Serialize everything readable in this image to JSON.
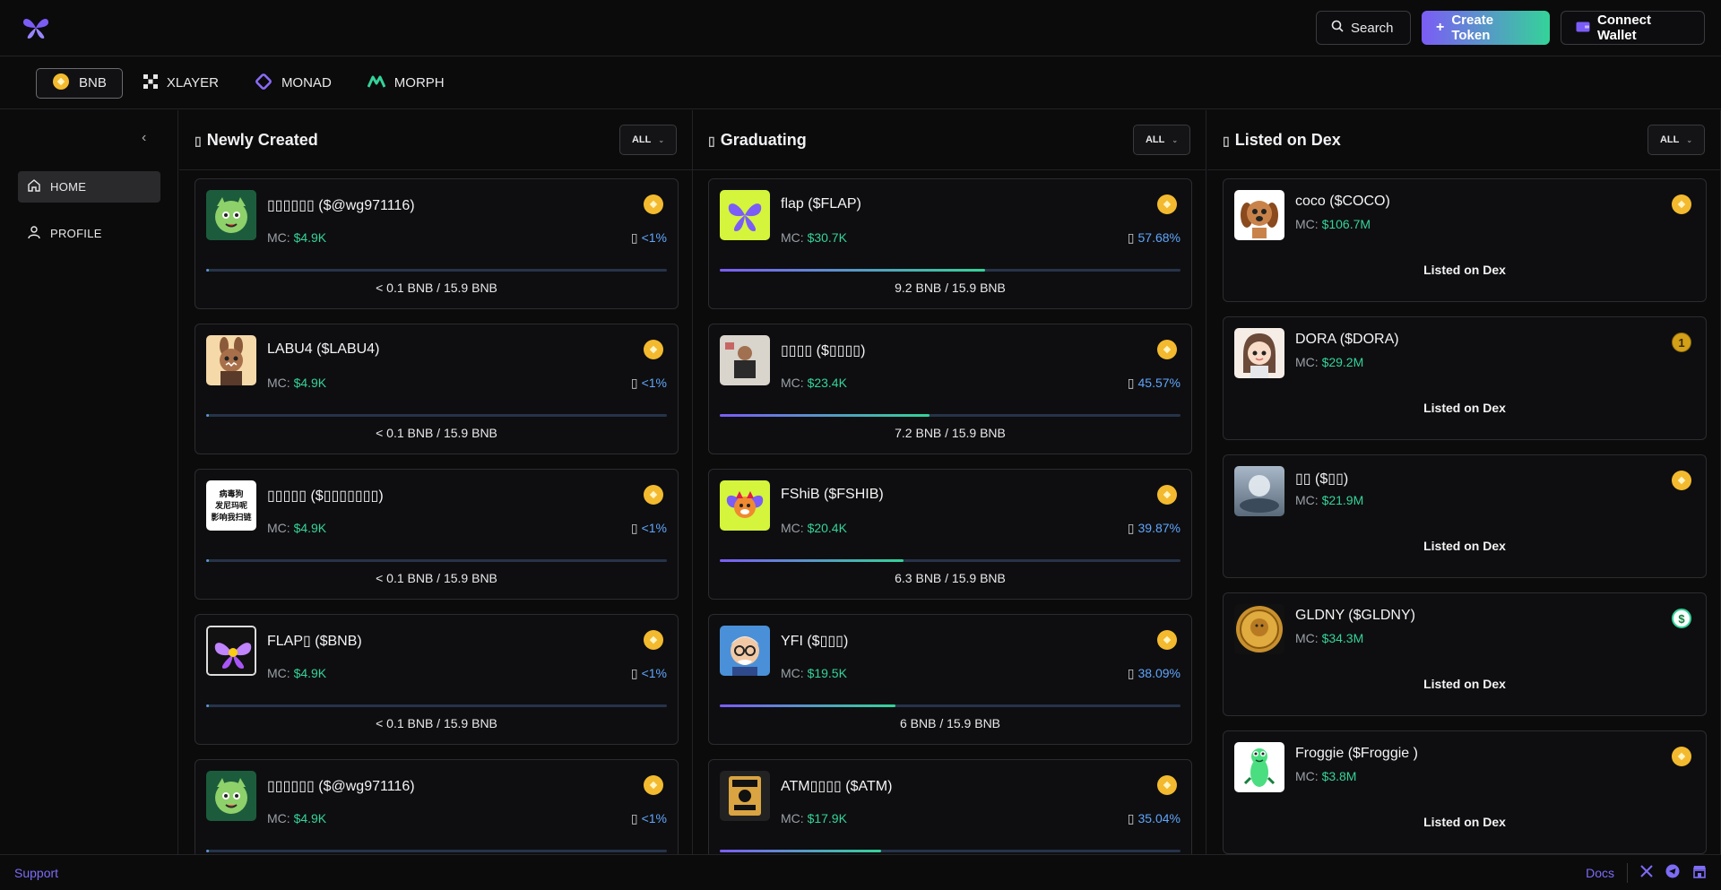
{
  "header": {
    "search_label": "Search",
    "create_label": "Create Token",
    "wallet_label": "Connect Wallet"
  },
  "chains": [
    {
      "label": "BNB",
      "icon": "bnb-coin-icon",
      "active": true
    },
    {
      "label": "XLAYER",
      "icon": "xlayer-icon"
    },
    {
      "label": "MONAD",
      "icon": "monad-icon"
    },
    {
      "label": "MORPH",
      "icon": "morph-icon"
    }
  ],
  "sidebar": {
    "items": [
      {
        "label": "HOME",
        "icon": "home-icon"
      },
      {
        "label": "PROFILE",
        "icon": "user-icon"
      }
    ]
  },
  "columns": [
    {
      "title": "Newly Created",
      "filter": "ALL"
    },
    {
      "title": "Graduating",
      "filter": "ALL"
    },
    {
      "title": "Listed on Dex",
      "filter": "ALL"
    }
  ],
  "newly_created": [
    {
      "name": "▯▯▯▯▯▯ ($@wg971116)",
      "mc_label": "MC:",
      "mc": "$4.9K",
      "pct": "<1%",
      "progress": 0.003,
      "progress_label": "< 0.1 BNB / 15.9 BNB"
    },
    {
      "name": "LABU4 ($LABU4)",
      "mc_label": "MC:",
      "mc": "$4.9K",
      "pct": "<1%",
      "progress": 0.003,
      "progress_label": "< 0.1 BNB / 15.9 BNB"
    },
    {
      "name": "▯▯▯▯▯ ($▯▯▯▯▯▯▯)",
      "mc_label": "MC:",
      "mc": "$4.9K",
      "pct": "<1%",
      "progress": 0.003,
      "progress_label": "< 0.1 BNB / 15.9 BNB",
      "avatar_text": [
        "病毒狗",
        "发尼玛呢",
        "影响我扫链"
      ]
    },
    {
      "name": "FLAP▯ ($BNB)",
      "mc_label": "MC:",
      "mc": "$4.9K",
      "pct": "<1%",
      "progress": 0.003,
      "progress_label": "< 0.1 BNB / 15.9 BNB"
    },
    {
      "name": "▯▯▯▯▯▯ ($@wg971116)",
      "mc_label": "MC:",
      "mc": "$4.9K",
      "pct": "<1%",
      "progress": 0.003,
      "progress_label": ""
    }
  ],
  "graduating": [
    {
      "name": "flap ($FLAP)",
      "mc_label": "MC:",
      "mc": "$30.7K",
      "pct": "57.68%",
      "progress": 0.5768,
      "progress_label": "9.2 BNB / 15.9 BNB"
    },
    {
      "name": "▯▯▯▯ ($▯▯▯▯)",
      "mc_label": "MC:",
      "mc": "$23.4K",
      "pct": "45.57%",
      "progress": 0.4557,
      "progress_label": "7.2 BNB / 15.9 BNB"
    },
    {
      "name": "FShiB ($FSHIB)",
      "mc_label": "MC:",
      "mc": "$20.4K",
      "pct": "39.87%",
      "progress": 0.3987,
      "progress_label": "6.3 BNB / 15.9 BNB"
    },
    {
      "name": "YFI ($▯▯▯)",
      "mc_label": "MC:",
      "mc": "$19.5K",
      "pct": "38.09%",
      "progress": 0.3809,
      "progress_label": "6 BNB / 15.9 BNB"
    },
    {
      "name": "ATM▯▯▯▯ ($ATM)",
      "mc_label": "MC:",
      "mc": "$17.9K",
      "pct": "35.04%",
      "progress": 0.3504,
      "progress_label": ""
    }
  ],
  "listed": [
    {
      "name": "coco ($COCO)",
      "mc_label": "MC:",
      "mc": "$106.7M",
      "status": "Listed on Dex"
    },
    {
      "name": "DORA ($DORA)",
      "mc_label": "MC:",
      "mc": "$29.2M",
      "status": "Listed on Dex",
      "badge": "1"
    },
    {
      "name": "▯▯ ($▯▯)",
      "mc_label": "MC:",
      "mc": "$21.9M",
      "status": "Listed on Dex"
    },
    {
      "name": "GLDNY ($GLDNY)",
      "mc_label": "MC:",
      "mc": "$34.3M",
      "status": "Listed on Dex",
      "badge": "$"
    },
    {
      "name": "Froggie ($Froggie )",
      "mc_label": "MC:",
      "mc": "$3.8M",
      "status": "Listed on Dex"
    }
  ],
  "footer": {
    "support": "Support",
    "docs": "Docs"
  },
  "colors": {
    "accent": "#7c6cf6",
    "green": "#34d399",
    "blue": "#60a5fa",
    "bnb": "#f3ba2f"
  }
}
